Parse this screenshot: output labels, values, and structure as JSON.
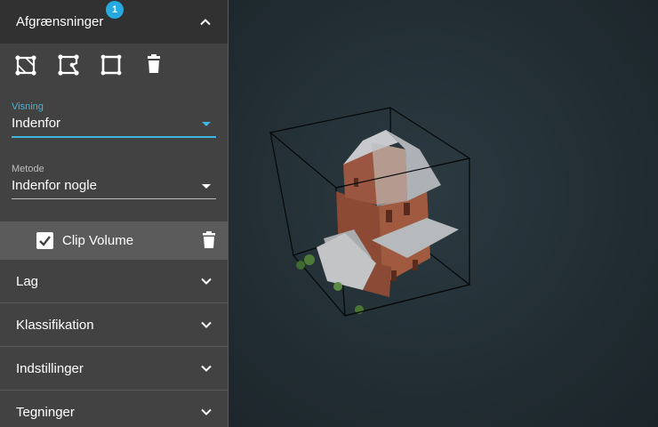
{
  "sidebar": {
    "clip_panel": {
      "title": "Afgrænsninger",
      "badge": "1"
    },
    "tools": [
      {
        "icon": "clip-volume-tool-icon"
      },
      {
        "icon": "clip-polygon-tool-icon"
      },
      {
        "icon": "clip-square-tool-icon"
      },
      {
        "icon": "trash-icon"
      }
    ],
    "visning": {
      "label": "Visning",
      "value": "Indenfor"
    },
    "metode": {
      "label": "Metode",
      "value": "Indenfor nogle"
    },
    "clip_volume": {
      "label": "Clip Volume",
      "checked": true
    },
    "sections": [
      {
        "title": "Lag"
      },
      {
        "title": "Klassifikation"
      },
      {
        "title": "Indstillinger"
      },
      {
        "title": "Tegninger"
      }
    ]
  },
  "colors": {
    "accent": "#3fb6e0",
    "badge": "#26a9e0",
    "panel": "#424242",
    "viewport": "#1f2a30"
  }
}
